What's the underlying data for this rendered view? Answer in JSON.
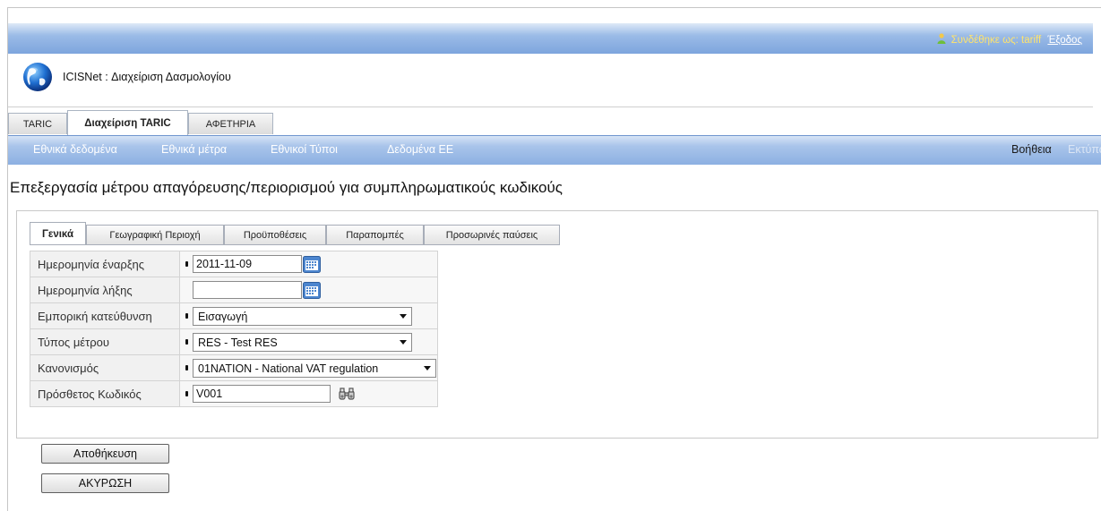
{
  "login": {
    "label": "Συνδέθηκε ως:",
    "user": "tariff",
    "logout": "Έξοδος"
  },
  "app": {
    "title": "ICISNet : Διαχείριση Δασμολογίου"
  },
  "main_tabs": [
    {
      "label": "TARIC",
      "active": false
    },
    {
      "label": "Διαχείριση TARIC",
      "active": true
    },
    {
      "label": "ΑΦΕΤΗΡΙΑ",
      "active": false
    }
  ],
  "nav": {
    "items": [
      "Εθνικά δεδομένα",
      "Εθνικά μέτρα",
      "Εθνικοί Τύποι",
      "Δεδομένα ΕΕ"
    ],
    "help": "Βοήθεια",
    "print": "Εκτύπωση"
  },
  "page": {
    "title": "Επεξεργασία μέτρου απαγόρευσης/περιορισμού για συμπληρωματικούς κωδικούς"
  },
  "sub_tabs": [
    {
      "label": "Γενικά",
      "active": true
    },
    {
      "label": "Γεωγραφική Περιοχή",
      "active": false
    },
    {
      "label": "Προϋποθέσεις",
      "active": false
    },
    {
      "label": "Παραπομπές",
      "active": false
    },
    {
      "label": "Προσωρινές παύσεις",
      "active": false
    }
  ],
  "form": {
    "start_date": {
      "label": "Ημερομηνία έναρξης",
      "value": "2011-11-09",
      "required": true
    },
    "end_date": {
      "label": "Ημερομηνία λήξης",
      "value": "",
      "required": false
    },
    "trade_direction": {
      "label": "Εμπορική κατεύθυνση",
      "value": "Εισαγωγή",
      "required": true
    },
    "measure_type": {
      "label": "Τύπος μέτρου",
      "value": "RES - Test RES",
      "required": true
    },
    "regulation": {
      "label": "Κανονισμός",
      "value": "01NATION - National VAT regulation",
      "required": true
    },
    "additional_code": {
      "label": "Πρόσθετος Κωδικός",
      "value": "V001",
      "required": true
    }
  },
  "buttons": {
    "save": "Αποθήκευση",
    "cancel": "ΑΚΥΡΩΣΗ"
  },
  "colors": {
    "bar_blue": "#8cb0e2",
    "login_label": "#ffe36b"
  },
  "icons": [
    "user-icon",
    "globe-logo-icon",
    "calendar-icon",
    "binoculars-icon",
    "dropdown-arrow-icon"
  ]
}
